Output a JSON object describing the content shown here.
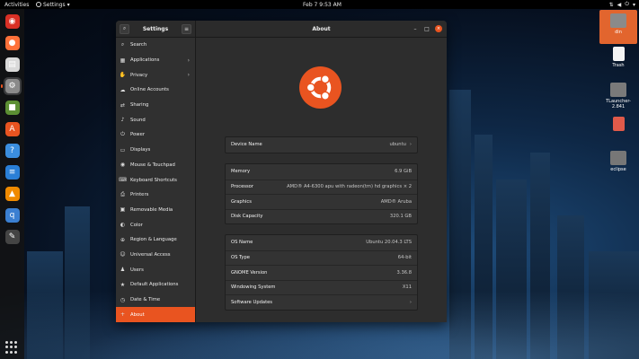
{
  "topbar": {
    "activities": "Activities",
    "app_menu": "Settings",
    "clock": "Feb 7  9:53 AM"
  },
  "dock": {
    "items": [
      {
        "name": "chrome-icon",
        "glyph": "◉",
        "color": "#d93025"
      },
      {
        "name": "firefox-icon",
        "glyph": "●",
        "color": "#ff7139"
      },
      {
        "name": "files-icon",
        "glyph": "▤",
        "color": "#d9d9d9"
      },
      {
        "name": "settings-icon",
        "glyph": "⚙",
        "color": "#8a8a8a"
      },
      {
        "name": "minecraft-icon",
        "glyph": "■",
        "color": "#5c8f33"
      },
      {
        "name": "software-icon",
        "glyph": "A",
        "color": "#e95420"
      },
      {
        "name": "help-icon",
        "glyph": "?",
        "color": "#3b8ede"
      },
      {
        "name": "writer-icon",
        "glyph": "≡",
        "color": "#2a7fd6"
      },
      {
        "name": "vlc-icon",
        "glyph": "▲",
        "color": "#f08a00"
      },
      {
        "name": "qbittorrent-icon",
        "glyph": "q",
        "color": "#3b7fd1"
      },
      {
        "name": "inkscape-icon",
        "glyph": "✎",
        "color": "#444"
      }
    ]
  },
  "desktop": {
    "icons": [
      {
        "name": "desktop-icon-din",
        "label": "din",
        "color": "#8a8a8a"
      },
      {
        "name": "desktop-icon-trash",
        "label": "Trash",
        "color": "#f4f4f4"
      },
      {
        "name": "desktop-icon-tlauncher",
        "label": "TLauncher-2.841",
        "color": "#7a7a7a"
      },
      {
        "name": "desktop-icon-pdf",
        "label": "",
        "color": "#e05a4a"
      },
      {
        "name": "desktop-icon-eclipse",
        "label": "eclipse",
        "color": "#777"
      }
    ]
  },
  "window": {
    "sidebar_title": "Settings",
    "page_title": "About",
    "window_controls": {
      "minimize": "–",
      "maximize": "□",
      "close": "×"
    }
  },
  "sidebar": {
    "items": [
      {
        "label": "Search",
        "icon": "⌕",
        "chevron": ""
      },
      {
        "label": "Applications",
        "icon": "▦",
        "chevron": "›"
      },
      {
        "label": "Privacy",
        "icon": "✋",
        "chevron": "›"
      },
      {
        "label": "Online Accounts",
        "icon": "☁",
        "chevron": ""
      },
      {
        "label": "Sharing",
        "icon": "⇄",
        "chevron": ""
      },
      {
        "label": "Sound",
        "icon": "♪",
        "chevron": ""
      },
      {
        "label": "Power",
        "icon": "⏻",
        "chevron": ""
      },
      {
        "label": "Displays",
        "icon": "▭",
        "chevron": ""
      },
      {
        "label": "Mouse & Touchpad",
        "icon": "◉",
        "chevron": ""
      },
      {
        "label": "Keyboard Shortcuts",
        "icon": "⌨",
        "chevron": ""
      },
      {
        "label": "Printers",
        "icon": "⎙",
        "chevron": ""
      },
      {
        "label": "Removable Media",
        "icon": "▣",
        "chevron": ""
      },
      {
        "label": "Color",
        "icon": "◐",
        "chevron": ""
      },
      {
        "label": "Region & Language",
        "icon": "⊕",
        "chevron": ""
      },
      {
        "label": "Universal Access",
        "icon": "☺",
        "chevron": ""
      },
      {
        "label": "Users",
        "icon": "♟",
        "chevron": ""
      },
      {
        "label": "Default Applications",
        "icon": "★",
        "chevron": ""
      },
      {
        "label": "Date & Time",
        "icon": "◷",
        "chevron": ""
      },
      {
        "label": "About",
        "icon": "+",
        "chevron": ""
      }
    ],
    "active_index": 18
  },
  "about": {
    "device": [
      {
        "label": "Device Name",
        "value": "ubuntu",
        "arrow": "›"
      }
    ],
    "hardware": [
      {
        "label": "Memory",
        "value": "6.9 GiB"
      },
      {
        "label": "Processor",
        "value": "AMD® A4-6300 apu with radeon(tm) hd graphics × 2"
      },
      {
        "label": "Graphics",
        "value": "AMD® Aruba"
      },
      {
        "label": "Disk Capacity",
        "value": "320.1 GB"
      }
    ],
    "software": [
      {
        "label": "OS Name",
        "value": "Ubuntu 20.04.3 LTS",
        "arrow": ""
      },
      {
        "label": "OS Type",
        "value": "64-bit",
        "arrow": ""
      },
      {
        "label": "GNOME Version",
        "value": "3.36.8",
        "arrow": ""
      },
      {
        "label": "Windowing System",
        "value": "X11",
        "arrow": ""
      },
      {
        "label": "Software Updates",
        "value": "",
        "arrow": "›"
      }
    ]
  },
  "colors": {
    "accent": "#e95420"
  }
}
